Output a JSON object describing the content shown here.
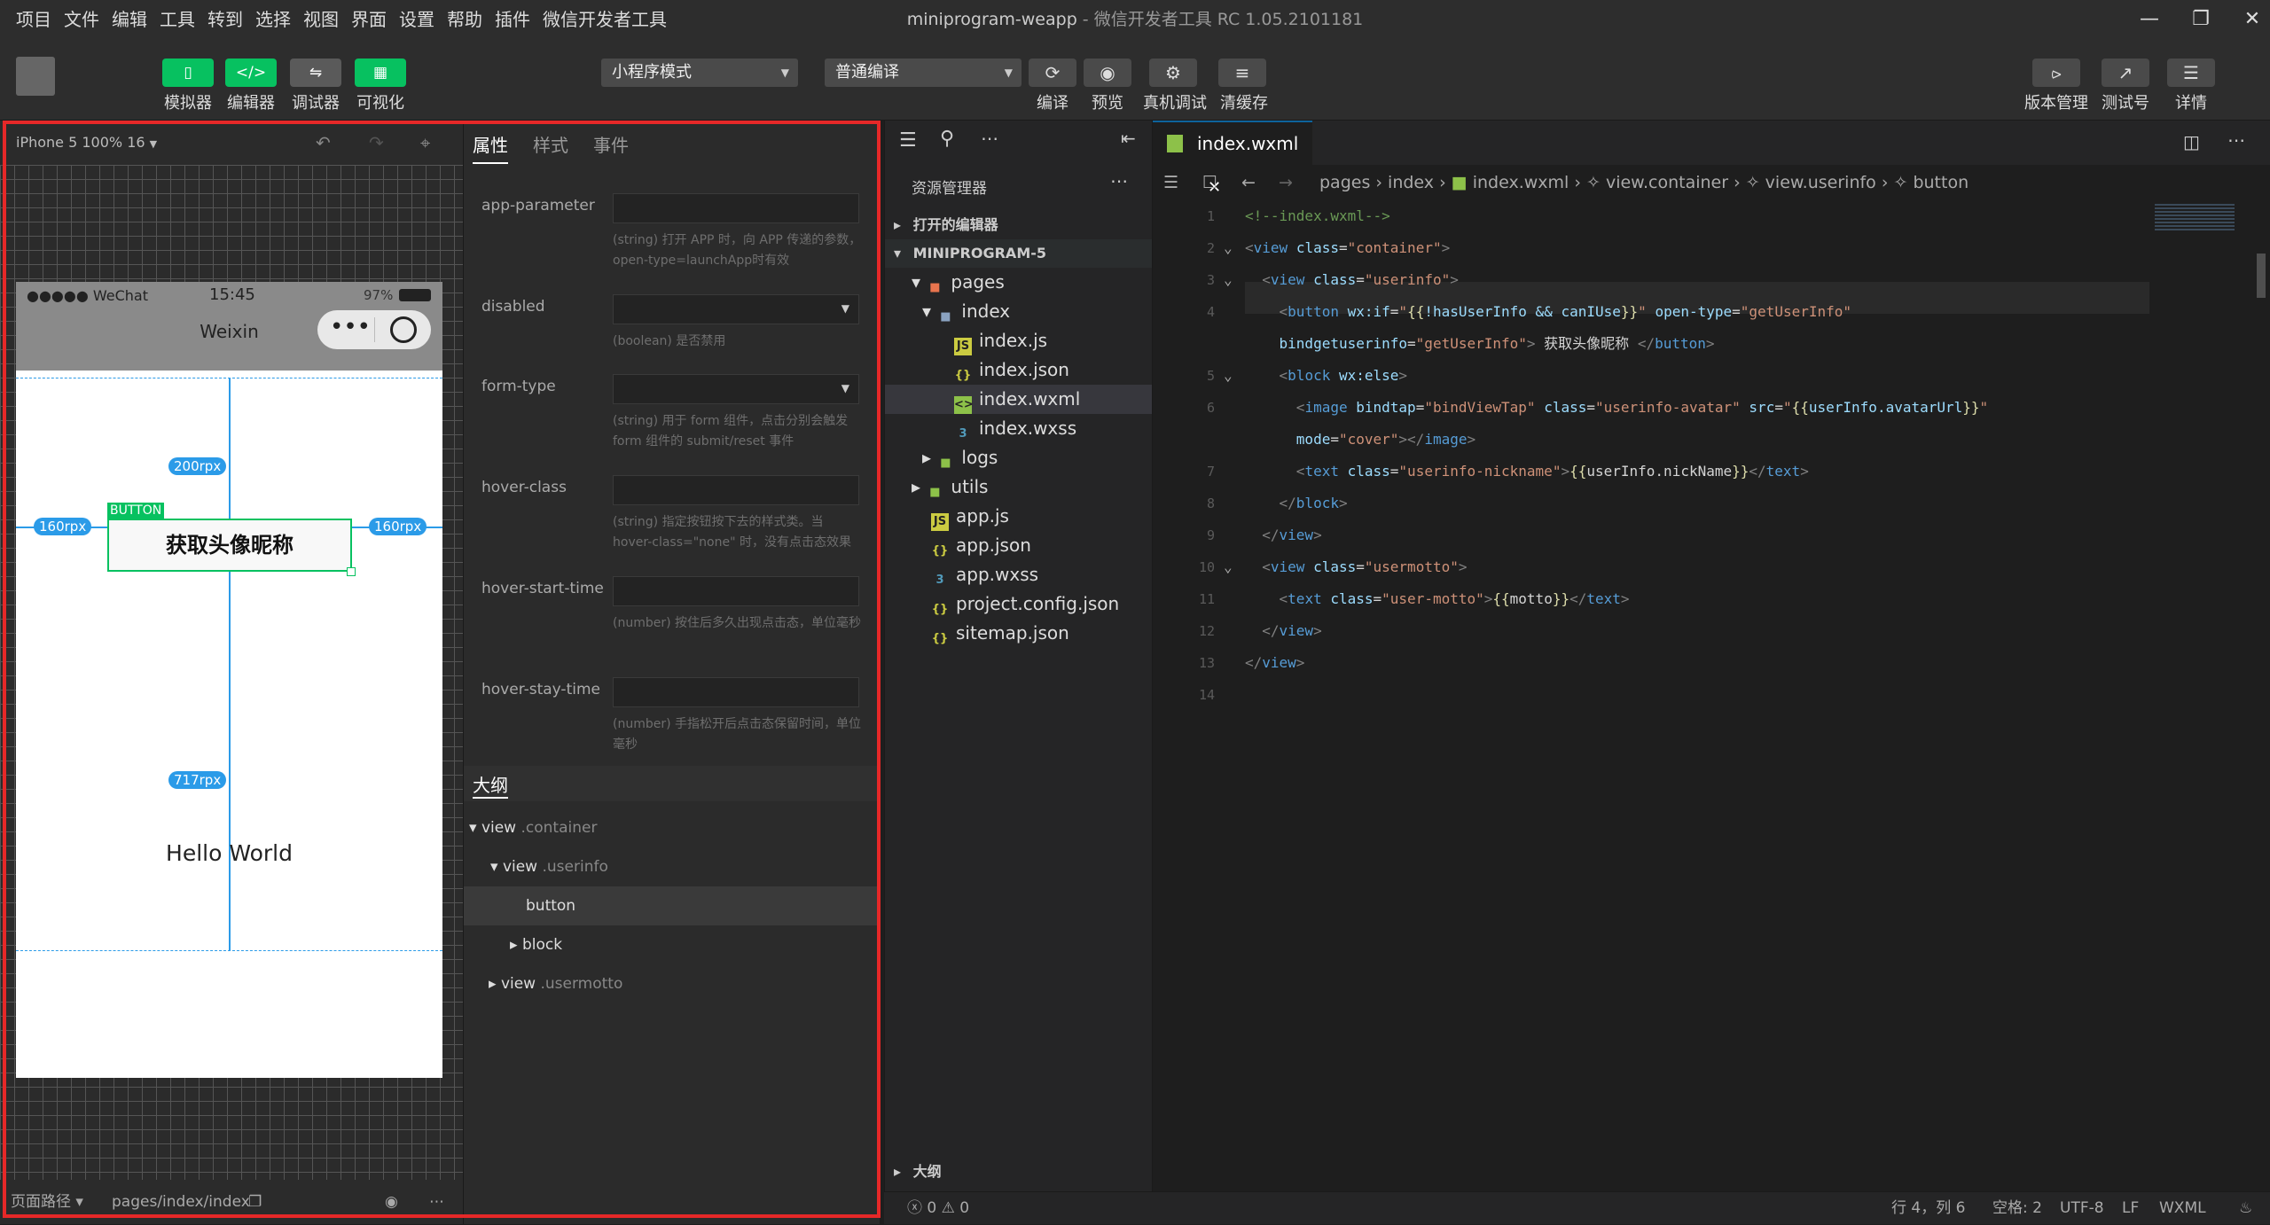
{
  "menu": [
    "项目",
    "文件",
    "编辑",
    "工具",
    "转到",
    "选择",
    "视图",
    "界面",
    "设置",
    "帮助",
    "插件",
    "微信开发者工具"
  ],
  "window_title": {
    "project": "miniprogram-weapp",
    "app": "微信开发者工具 RC 1.05.2101181"
  },
  "toolbar": {
    "simulator": "模拟器",
    "editor": "编辑器",
    "debugger": "调试器",
    "visual": "可视化",
    "mode": "小程序模式",
    "compile_mode": "普通编译",
    "compile": "编译",
    "preview": "预览",
    "remote_debug": "真机调试",
    "clear_cache": "清缓存",
    "version": "版本管理",
    "test": "测试号",
    "details": "详情"
  },
  "simulator": {
    "device": "iPhone 5 100% 16",
    "carrier": "●●●●● WeChat",
    "time": "15:45",
    "battery": "97%",
    "nav_title": "Weixin",
    "button_tag": "BUTTON",
    "button_text": "获取头像昵称",
    "hello": "Hello World",
    "m_top": "200rpx",
    "m_left": "160rpx",
    "m_right": "160rpx",
    "m_height": "717rpx",
    "page_path_label": "页面路径",
    "page_path": "pages/index/index"
  },
  "attr_panel": {
    "tabs": [
      "属性",
      "样式",
      "事件"
    ],
    "attrs": [
      {
        "name": "app-parameter",
        "desc": "(string) 打开 APP 时，向 APP 传递的参数，open-type=launchApp时有效"
      },
      {
        "name": "disabled",
        "desc": "(boolean) 是否禁用"
      },
      {
        "name": "form-type",
        "desc": "(string) 用于 form 组件，点击分别会触发 form 组件的 submit/reset 事件"
      },
      {
        "name": "hover-class",
        "desc": "(string) 指定按钮按下去的样式类。当 hover-class=\"none\" 时，没有点击态效果"
      },
      {
        "name": "hover-start-time",
        "desc": "(number) 按住后多久出现点击态，单位毫秒"
      },
      {
        "name": "hover-stay-time",
        "desc": "(number) 手指松开后点击态保留时间，单位毫秒"
      }
    ],
    "outline_title": "大纲",
    "outline": [
      {
        "tag": "view",
        "cls": ".container"
      },
      {
        "tag": "view",
        "cls": ".userinfo"
      },
      {
        "tag": "button",
        "cls": ""
      },
      {
        "tag": "block",
        "cls": ""
      },
      {
        "tag": "view",
        "cls": ".usermotto"
      }
    ]
  },
  "explorer": {
    "title": "资源管理器",
    "open_editors": "打开的编辑器",
    "project": "MINIPROGRAM-5",
    "outline": "大纲",
    "tree": [
      "pages",
      "index",
      "index.js",
      "index.json",
      "index.wxml",
      "index.wxss",
      "logs",
      "utils",
      "app.js",
      "app.json",
      "app.wxss",
      "project.config.json",
      "sitemap.json"
    ]
  },
  "editor": {
    "tab": "index.wxml",
    "breadcrumb": [
      "pages",
      "index",
      "index.wxml",
      "view.container",
      "view.userinfo",
      "button"
    ],
    "lines": [
      "1",
      "2",
      "3",
      "4",
      "",
      "5",
      "6",
      "",
      "7",
      "8",
      "9",
      "10",
      "11",
      "12",
      "13",
      "14"
    ]
  },
  "status": {
    "problems": "0 ⚠ 0",
    "position": "行 4，列 6",
    "spaces": "空格: 2",
    "encoding": "UTF-8",
    "eol": "LF",
    "lang": "WXML"
  },
  "colors": {
    "accent": "#07c160",
    "highlight": "#e62828",
    "measure": "#2b9be8"
  }
}
